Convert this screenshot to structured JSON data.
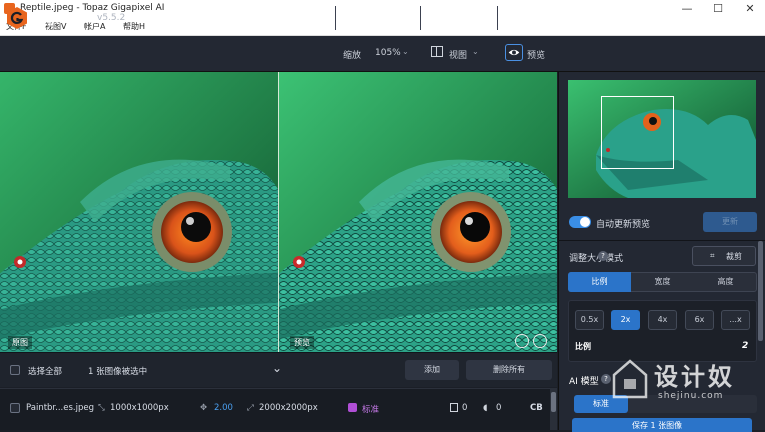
{
  "window": {
    "title": "Reptile.jpeg - Topaz Gigapixel AI",
    "controls": [
      "—",
      "☐",
      "✕"
    ]
  },
  "menu": {
    "items": [
      "文件F",
      "视图V",
      "帐户A",
      "帮助H"
    ]
  },
  "header": {
    "brand": "Gigapixel AI",
    "version": "v5.5.2",
    "zoom_label": "缩放",
    "zoom_value": "105%",
    "view_label": "视图",
    "preview_label": "预览"
  },
  "viewer": {
    "left_tag": "原图",
    "right_tag": "预览"
  },
  "image_bar": {
    "select_all": "选择全部",
    "selected_count": "1 张图像被选中",
    "add_button": "添加",
    "remove_all_button": "删除所有"
  },
  "file_row": {
    "name": "Paintbr...es.jpeg",
    "input_size": "1000x1000px",
    "scale": "2.00",
    "output_size": "2000x2000px",
    "model": "标准",
    "value_a": "0",
    "value_b": "0",
    "format": "CB"
  },
  "sidebar": {
    "auto_update_label": "自动更新预览",
    "apply_label": "更新",
    "resize_mode_label": "调整大小模式",
    "crop_label": "裁剪",
    "tabs": [
      "比例",
      "宽度",
      "高度"
    ],
    "scale_buttons": [
      "0.5x",
      "2x",
      "4x",
      "6x",
      "...x"
    ],
    "scale_label": "比例",
    "scale_value": "2",
    "model_label": "AI 模型",
    "model_selected": "标准",
    "save_label": "保存 1 张图像"
  },
  "watermark": {
    "text": "设计奴",
    "url": "shejinu.com"
  },
  "colors": {
    "accent": "#2b74c9",
    "background": "#1b1f27",
    "panel": "#232833",
    "logo": "#e8651e",
    "model_badge": "#b04fd6"
  }
}
